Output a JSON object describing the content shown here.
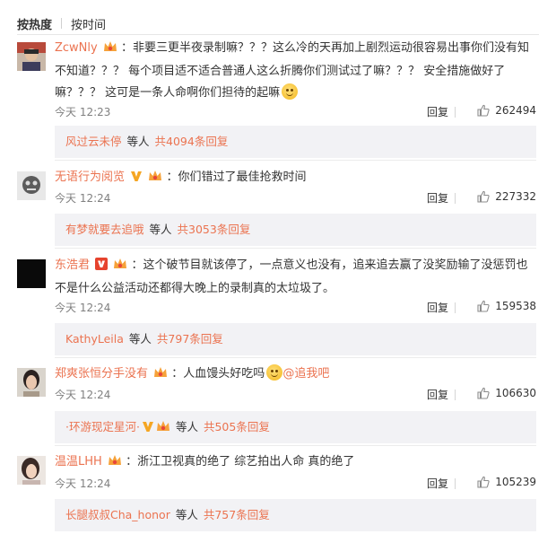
{
  "sort": {
    "hot": "按热度",
    "time": "按时间"
  },
  "colors": {
    "accent": "#eb7350",
    "subbox": "#f2f2f5"
  },
  "comments": [
    {
      "user": "ZcwNly",
      "text": "：非要三更半夜录制嘛？？？这么冷的天再加上剧烈运动很容易出事你们没有知不知道？？？ 每个项目适不适合普通人这么折腾你们测试过了嘛？？？ 安全措施做好了嘛？？？ 这可是一条人命啊你们担待的起嘛",
      "time": "今天 12:23",
      "reply": "回复",
      "likes": "262494",
      "sub_user": "风过云未停",
      "sub_mid": "等人",
      "sub_count": "共4094条回复"
    },
    {
      "user": "无语行为阅览",
      "text": "：你们错过了最佳抢救时间",
      "time": "今天 12:24",
      "reply": "回复",
      "likes": "227332",
      "sub_user": "有梦就要去追哦",
      "sub_mid": "等人",
      "sub_count": "共3053条回复"
    },
    {
      "user": "东浩君",
      "text": "：这个破节目就该停了，一点意义也没有，追来追去赢了没奖励输了没惩罚也不是什么公益活动还都得大晚上的录制真的太垃圾了。",
      "time": "今天 12:24",
      "reply": "回复",
      "likes": "159538",
      "sub_user": "KathyLeila",
      "sub_mid": "等人",
      "sub_count": "共797条回复"
    },
    {
      "user": "郑爽张恒分手没有",
      "text_a": "：人血馒头好吃吗",
      "text_b": "@追我吧",
      "time": "今天 12:24",
      "reply": "回复",
      "likes": "106630",
      "sub_user": "·环游现定星河·",
      "sub_mid": "等人",
      "sub_count": "共505条回复"
    },
    {
      "user": "温温LHH",
      "text": "：浙江卫视真的绝了 综艺拍出人命 真的绝了",
      "time": "今天 12:24",
      "reply": "回复",
      "likes": "105239",
      "sub_user": "长腿叔叔Cha_honor",
      "sub_mid": "等人",
      "sub_count": "共757条回复"
    }
  ]
}
